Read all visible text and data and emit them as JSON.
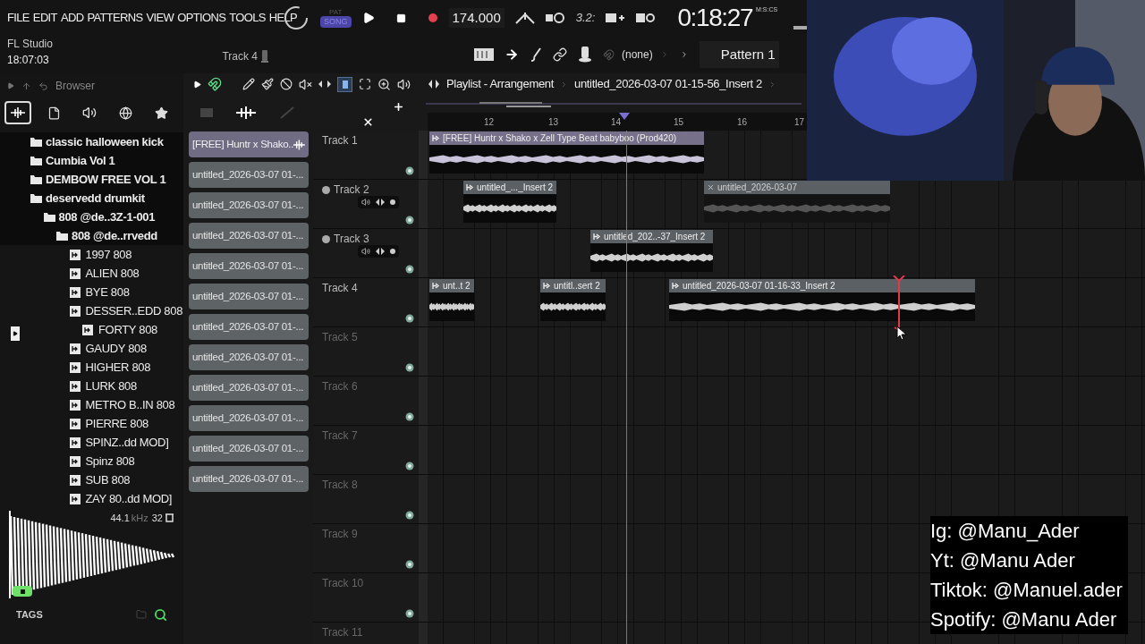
{
  "menu": [
    "FILE",
    "EDIT",
    "ADD",
    "PATTERNS",
    "VIEW",
    "OPTIONS",
    "TOOLS",
    "HELP"
  ],
  "app": {
    "name": "FL Studio",
    "clock": "18:07:03"
  },
  "transport": {
    "pat_label": "PAT",
    "song_label": "SONG",
    "song_mode": true,
    "tempo": "174.000",
    "time": "0:18:27",
    "time_format": "M:S:CS",
    "beat_label": "3.2:"
  },
  "channel_bar": {
    "track": "Track 4",
    "snap": "(none)",
    "pattern": "Pattern 1"
  },
  "browser": {
    "title": "Browser",
    "tabs": [
      {
        "selected": true
      },
      {
        "selected": false
      },
      {
        "selected": false
      },
      {
        "selected": false
      },
      {
        "selected": false
      }
    ],
    "tree": [
      {
        "label": "classic halloween kick",
        "kind": "folder"
      },
      {
        "label": "Cumbia Vol 1",
        "kind": "folder"
      },
      {
        "label": "DEMBOW FREE VOL 1",
        "kind": "folder"
      },
      {
        "label": "deservedd drumkit",
        "kind": "folder",
        "children": [
          {
            "label": "808 @de..3Z-1-001",
            "kind": "folder",
            "children": [
              {
                "label": "808 @de..rrvedd",
                "kind": "folder",
                "children": [
                  {
                    "label": "1997 808",
                    "kind": "file"
                  },
                  {
                    "label": "ALIEN 808",
                    "kind": "file"
                  },
                  {
                    "label": "BYE 808",
                    "kind": "file"
                  },
                  {
                    "label": "DESSER..EDD 808",
                    "kind": "file",
                    "children": [
                      {
                        "label": "FORTY 808",
                        "kind": "file"
                      }
                    ]
                  },
                  {
                    "label": "GAUDY 808",
                    "kind": "file"
                  },
                  {
                    "label": "HIGHER 808",
                    "kind": "file"
                  },
                  {
                    "label": "LURK 808",
                    "kind": "file"
                  },
                  {
                    "label": "METRO B..IN 808",
                    "kind": "file"
                  },
                  {
                    "label": "PIERRE 808",
                    "kind": "file"
                  },
                  {
                    "label": "SPINZ..dd MOD]",
                    "kind": "file"
                  },
                  {
                    "label": "Spinz 808",
                    "kind": "file"
                  },
                  {
                    "label": "SUB 808",
                    "kind": "file"
                  },
                  {
                    "label": "ZAY 80..dd MOD]",
                    "kind": "file"
                  }
                ]
              }
            ]
          }
        ]
      }
    ],
    "preview": {
      "rate": "44.1",
      "unit": "kHz",
      "bits": "32"
    },
    "tags_label": "TAGS"
  },
  "patterns": [
    {
      "label": "[FREE] Huntr x Shako..",
      "selected": true
    },
    {
      "label": "untitled_2026-03-07 01-...",
      "selected": false
    },
    {
      "label": "untitled_2026-03-07 01-...",
      "selected": false
    },
    {
      "label": "untitled_2026-03-07 01-...",
      "selected": false
    },
    {
      "label": "untitled_2026-03-07 01-...",
      "selected": false
    },
    {
      "label": "untitled_2026-03-07 01-...",
      "selected": false
    },
    {
      "label": "untitled_2026-03-07 01-...",
      "selected": false
    },
    {
      "label": "untitled_2026-03-07 01-...",
      "selected": false
    },
    {
      "label": "untitled_2026-03-07 01-...",
      "selected": false
    },
    {
      "label": "untitled_2026-03-07 01-...",
      "selected": false
    },
    {
      "label": "untitled_2026-03-07 01-...",
      "selected": false
    },
    {
      "label": "untitled_2026-03-07 01-...",
      "selected": false
    }
  ],
  "playlist": {
    "title": "Playlist - Arrangement",
    "breadcrumb": "untitled_2026-03-07 01-15-56_Insert 2",
    "ruler": [
      "12",
      "13",
      "14",
      "15",
      "16",
      "17"
    ],
    "tracks": [
      {
        "name": "Track 1",
        "controls": false,
        "clips": [
          {
            "label": "[FREE] Huntr x Shako x Zell  Type Beat  babyboo  (Prod420)",
            "color": "#77708a",
            "muted": false
          }
        ]
      },
      {
        "name": "Track 2",
        "controls": true,
        "clips": [
          {
            "label": "untitled_..._Insert 2",
            "color": "#5b6064",
            "muted": false
          },
          {
            "label": "untitled_2026-03-07",
            "color": "#5b6064",
            "muted": true
          }
        ]
      },
      {
        "name": "Track 3",
        "controls": true,
        "clips": [
          {
            "label": "untitled_202..-37_Insert 2",
            "color": "#5b6064",
            "muted": false
          }
        ]
      },
      {
        "name": "Track 4",
        "controls": false,
        "clips": [
          {
            "label": "unt..t 2",
            "color": "#5b6064",
            "muted": false
          },
          {
            "label": "untitl..sert 2",
            "color": "#5b6064",
            "muted": false
          },
          {
            "label": "untitled_2026-03-07 01-16-33_Insert 2",
            "color": "#5b6064",
            "muted": false
          }
        ]
      },
      {
        "name": "Track 5",
        "controls": false
      },
      {
        "name": "Track 6",
        "controls": false
      },
      {
        "name": "Track 7",
        "controls": false
      },
      {
        "name": "Track 8",
        "controls": false
      },
      {
        "name": "Track 9",
        "controls": false
      },
      {
        "name": "Track 10",
        "controls": false
      },
      {
        "name": "Track 11",
        "controls": false
      }
    ]
  },
  "stream_overlay": [
    "Ig: @Manu_Ader",
    "Yt: @Manu Ader",
    "Tiktok: @Manuel.ader",
    "Spotify: @Manu Ader"
  ]
}
